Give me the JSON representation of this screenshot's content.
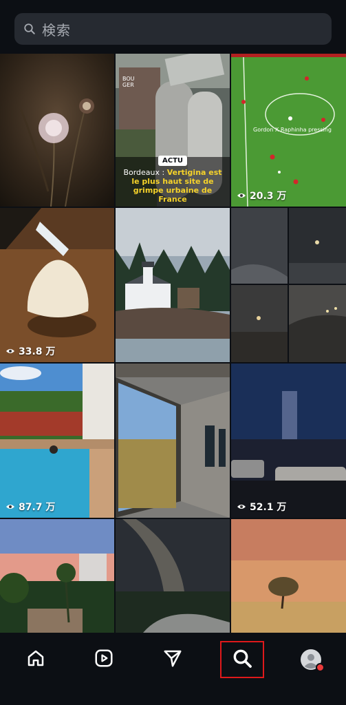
{
  "search": {
    "placeholder": "検索"
  },
  "tiles": [
    {
      "kind": "flower-dark"
    },
    {
      "kind": "silo-article",
      "badge": "ACTU",
      "brand": "BOU GER",
      "caption_prefix": "Bordeaux : ",
      "caption_highlight": "Vertigina est le plus haut site de grimpe urbaine de France"
    },
    {
      "kind": "football",
      "overlay": "Gordon X Raphinha pressing",
      "views": "20.3 万"
    },
    {
      "kind": "meringue",
      "views": "33.8 万"
    },
    {
      "kind": "lighthouse"
    },
    {
      "kind": "fog-collage"
    },
    {
      "kind": "pool",
      "views": "87.7 万"
    },
    {
      "kind": "building-reflection"
    },
    {
      "kind": "night-street",
      "views": "52.1 万"
    },
    {
      "kind": "sunset-palms"
    },
    {
      "kind": "milky-way"
    },
    {
      "kind": "lone-tree"
    }
  ],
  "nav": [
    {
      "name": "home",
      "icon": "home-icon"
    },
    {
      "name": "reels",
      "icon": "reels-icon"
    },
    {
      "name": "messages",
      "icon": "send-icon"
    },
    {
      "name": "search",
      "icon": "search-icon",
      "selected": true
    },
    {
      "name": "profile",
      "icon": "avatar-icon"
    }
  ],
  "colors": {
    "background": "#0c0f14",
    "search_bg": "#262a31",
    "selected_outline": "#e0191b",
    "notification_dot": "#ea3a3a"
  }
}
